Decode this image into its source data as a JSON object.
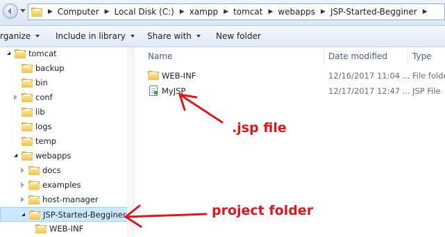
{
  "address_bar": {
    "breadcrumbs": [
      "Computer",
      "Local Disk (C:)",
      "xampp",
      "tomcat",
      "webapps",
      "JSP-Started-Begginer"
    ]
  },
  "toolbar": {
    "organize": "rganize",
    "include_in_library": "Include in library",
    "share_with": "Share with",
    "new_folder": "New folder"
  },
  "nav_tree": [
    {
      "label": "tomcat",
      "expander": "open"
    },
    {
      "label": "backup",
      "expander": "none"
    },
    {
      "label": "bin",
      "expander": "none"
    },
    {
      "label": "conf",
      "expander": "closed"
    },
    {
      "label": "lib",
      "expander": "none"
    },
    {
      "label": "logs",
      "expander": "none"
    },
    {
      "label": "temp",
      "expander": "none"
    },
    {
      "label": "webapps",
      "expander": "open"
    },
    {
      "label": "docs",
      "expander": "closed"
    },
    {
      "label": "examples",
      "expander": "closed"
    },
    {
      "label": "host-manager",
      "expander": "closed"
    },
    {
      "label": "JSP-Started-Begginer",
      "expander": "open",
      "selected": true
    },
    {
      "label": "WEB-INF",
      "expander": "none"
    }
  ],
  "columns": {
    "name": "Name",
    "date_modified": "Date modified",
    "type": "Type"
  },
  "files": [
    {
      "name": "WEB-INF",
      "date": "12/16/2017 11:04 ...",
      "type": "File folder",
      "icon": "folder-icon"
    },
    {
      "name": "MyJSP",
      "date": "12/17/2017 12:47 ...",
      "type": "JSP File",
      "icon": "jsp-file-icon"
    }
  ],
  "annotations": {
    "jsp_file": ".jsp file",
    "project_folder": "project folder",
    "color": "#e0161b"
  }
}
